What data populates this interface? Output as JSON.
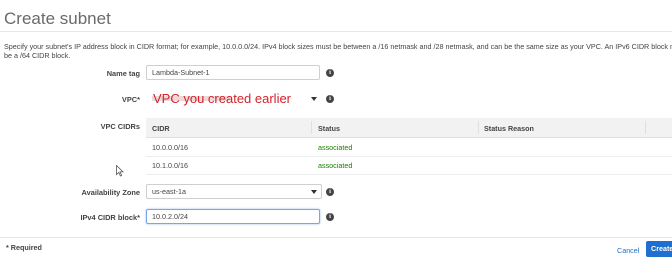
{
  "header": {
    "title": "Create subnet"
  },
  "description": {
    "line1": "Specify your subnet's IP address block in CIDR format; for example, 10.0.0.0/24. IPv4 block sizes must be between a /16 netmask and /28 netmask, and can be the same size as your VPC. An IPv6 CIDR block must",
    "line2": "be a /64 CIDR block."
  },
  "form": {
    "name_tag": {
      "label": "Name tag",
      "value": "Lambda-Subnet-1"
    },
    "vpc": {
      "label": "VPC*",
      "annotation": "VPC you created earlier"
    },
    "vpc_cidrs": {
      "label": "VPC CIDRs",
      "columns": [
        "CIDR",
        "Status",
        "Status Reason"
      ],
      "rows": [
        {
          "cidr": "10.0.0.0/16",
          "status": "associated",
          "reason": ""
        },
        {
          "cidr": "10.1.0.0/16",
          "status": "associated",
          "reason": ""
        }
      ]
    },
    "availability_zone": {
      "label": "Availability Zone",
      "value": "us-east-1a"
    },
    "ipv4_cidr": {
      "label": "IPv4 CIDR block*",
      "value": "10.0.2.0/24"
    }
  },
  "footer": {
    "required": "* Required",
    "cancel": "Cancel",
    "create": "Create"
  },
  "colors": {
    "link": "#1e6fbf",
    "primary_button": "#1f6fd1",
    "status_green": "#1d8102",
    "annotation_red": "#d4232a"
  },
  "icons": {
    "info": "info-circle-icon",
    "caret": "chevron-down-icon",
    "cursor": "mouse-pointer-icon"
  }
}
